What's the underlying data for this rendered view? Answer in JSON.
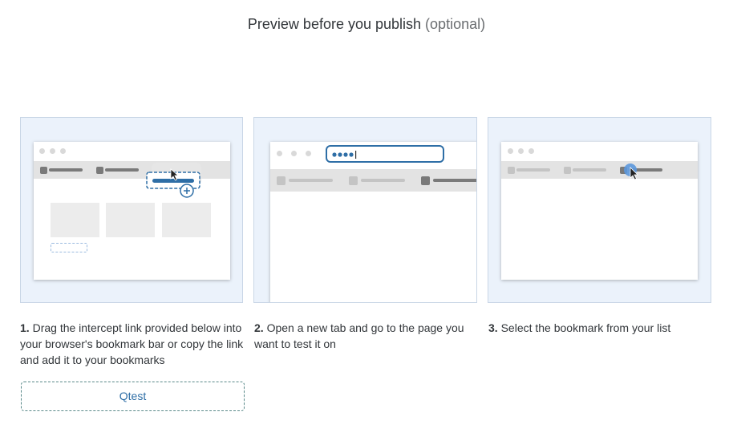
{
  "header": {
    "title": "Preview before you publish",
    "optional": "(optional)"
  },
  "steps": [
    {
      "number": "1.",
      "text": "Drag the intercept link provided below into your browser's bookmark bar or copy the link and add it to your bookmarks"
    },
    {
      "number": "2.",
      "text": "Open a new tab and go to the page you want to test it on"
    },
    {
      "number": "3.",
      "text": "Select the bookmark from your list"
    }
  ],
  "link_button": {
    "label": "Qtest"
  },
  "colors": {
    "accent": "#2e6ea6",
    "panel_bg": "#ebf2fb",
    "panel_border": "#c9d6e6"
  },
  "illustrations": {
    "step1": {
      "icons": [
        "bookmark-drag-icon",
        "plus-circle-icon",
        "cursor-icon"
      ]
    },
    "step2": {
      "icons": [
        "address-bar-icon"
      ]
    },
    "step3": {
      "icons": [
        "bookmark-select-icon",
        "cursor-icon"
      ]
    }
  }
}
